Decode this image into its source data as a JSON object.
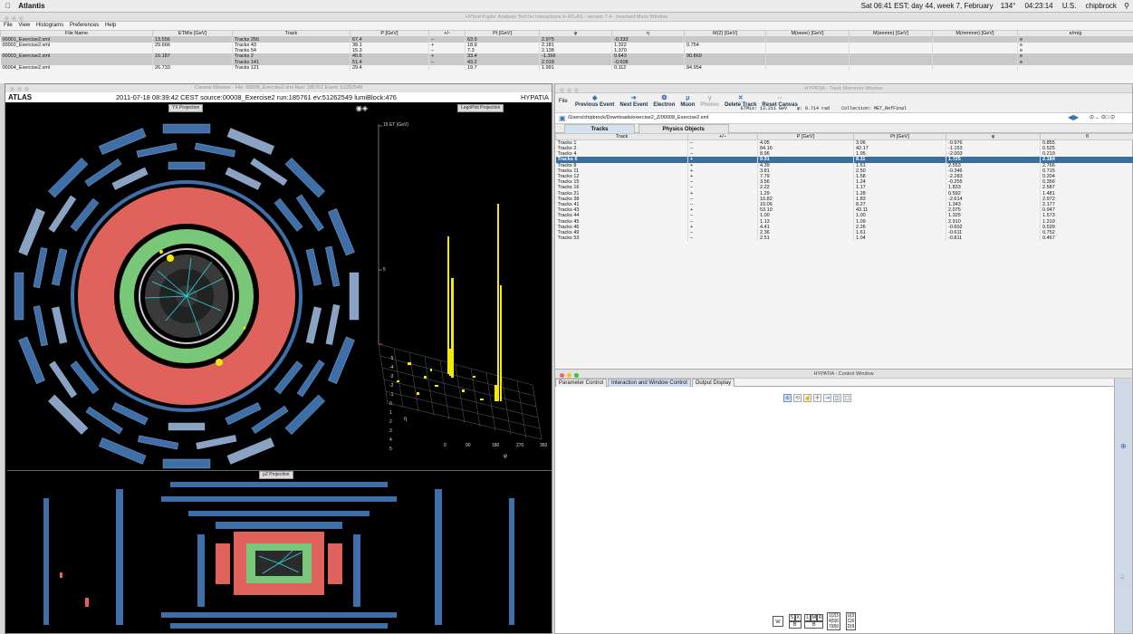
{
  "menubar": {
    "app": "Atlantis",
    "status": "Sat 06:41 EST; day 44, week 7, February",
    "battery": "134°",
    "clock": "04:23:14",
    "locale": "U.S.",
    "user": "chipbrock"
  },
  "main_window": {
    "title": "HYbrid Pupils' Analysis Tool for Interactions in ATLAS - version 7.4 - Invariant Mass Window",
    "menu": [
      "File",
      "View",
      "Histograms",
      "Preferences",
      "Help"
    ],
    "columns": [
      "File Name",
      "ETMis [GeV]",
      "Track",
      "P [GeV]",
      "+/-",
      "Pt [GeV]",
      "φ",
      "η",
      "M(2) [GeV]",
      "M(eeee) [GeV]",
      "M(eemm) [GeV]",
      "M(mmmm) [GeV]",
      "e/m/g"
    ],
    "rows": [
      {
        "file": "00001_Exercise2.xml",
        "etmis": "13.556",
        "track": "Tracks 256",
        "p": "67.4",
        "sign": "–",
        "pt": "63.9",
        "phi": "2.975",
        "eta": "-0.333",
        "m2": "",
        "emg": "e",
        "alt": true
      },
      {
        "file": "00002_Exercise2.xml",
        "etmis": "29.666",
        "track": "Tracks 43",
        "p": "38.1",
        "sign": "+",
        "pt": "18.9",
        "phi": "2.181",
        "eta": "1.322",
        "m2": "0.754",
        "emg": "e",
        "alt": false
      },
      {
        "file": "",
        "etmis": "",
        "track": "Tracks 54",
        "p": "15.3",
        "sign": "–",
        "pt": "7.3",
        "phi": "2.138",
        "eta": "1.370",
        "m2": "",
        "emg": "e",
        "alt": false
      },
      {
        "file": "00003_Exercise2.xml",
        "etmis": "16.187",
        "track": "Tracks 2",
        "p": "40.6",
        "sign": "+",
        "pt": "33.4",
        "phi": "-1.366",
        "eta": "0.643",
        "m2": "90.869",
        "emg": "e",
        "alt": true
      },
      {
        "file": "",
        "etmis": "",
        "track": "Tracks 141",
        "p": "51.4",
        "sign": "–",
        "pt": "43.2",
        "phi": "2.018",
        "eta": "-0.608",
        "m2": "",
        "emg": "e",
        "alt": true
      },
      {
        "file": "00004_Exercise2.xml",
        "etmis": "26.733",
        "track": "Tracks 121",
        "p": "29.4",
        "sign": "",
        "pt": "19.7",
        "phi": "1.991",
        "eta": "0.112",
        "m2": "84.954",
        "emg": "",
        "alt": false
      }
    ]
  },
  "canvas": {
    "title": "Canvas Window - File: 00008_Exercise2.xml  Run: 185761  Event: 51262549",
    "brand_left": "ATLAS",
    "event_info": "2011-07-18 08:39:42 CEST source:00008_Exercise2 run:185761 ev:51262549 lumiBlock:476",
    "brand_right": "HYPATIA",
    "yx_label": "YX Projection",
    "lego_label": "LegoPlot Projection",
    "rz_label": "ρZ Projection",
    "lego_et": "15 ET (GeV)",
    "lego_mid": "5",
    "phi_ticks": [
      "0",
      "90",
      "180",
      "270",
      "360"
    ],
    "phi_label": "φ",
    "eta_label": "η",
    "eta_ticks": [
      "-5",
      "-4",
      "-3",
      "-2",
      "-1",
      "0",
      "1",
      "2",
      "3",
      "4",
      "5"
    ]
  },
  "track_window": {
    "title": "HYPATIA - Track Momenta Window",
    "file_menu": "File",
    "buttons": [
      {
        "label": "Previous Event",
        "icon": "arrow-left-icon",
        "glyph": "◆",
        "disabled": false
      },
      {
        "label": "Next Event",
        "icon": "arrow-right-icon",
        "glyph": "➔",
        "disabled": false
      },
      {
        "label": "Electron",
        "icon": "electron-icon",
        "glyph": "❂",
        "disabled": false
      },
      {
        "label": "Muon",
        "icon": "muon-icon",
        "glyph": "μ",
        "disabled": false
      },
      {
        "label": "Photon",
        "icon": "photon-icon",
        "glyph": "γ",
        "disabled": true
      },
      {
        "label": "Delete Track",
        "icon": "delete-icon",
        "glyph": "✕",
        "disabled": false
      },
      {
        "label": "Reset Canvas",
        "icon": "reset-icon",
        "glyph": "⇔",
        "disabled": false
      }
    ],
    "etmis": "ETMis: 13.211 GeV",
    "phi": "φ: 0.714 rad",
    "collection": "Collection: MET_RefFinal",
    "path": "/Users/chipbrock/Downloads/exercise2_Z/00008_Exercise2.xml",
    "tabs": [
      "Tracks",
      "Physics Objects"
    ],
    "columns": [
      "Track",
      "+/–",
      "P [GeV]",
      "Pt [GeV]",
      "φ",
      "θ"
    ],
    "rows": [
      {
        "track": "Tracks 1",
        "sign": "–",
        "p": "4.05",
        "pt": "3.06",
        "phi": "-0.976",
        "theta": "0.855"
      },
      {
        "track": "Tracks 2",
        "sign": "–",
        "p": "84.16",
        "pt": "42.17",
        "phi": "-1.153",
        "theta": "0.525"
      },
      {
        "track": "Tracks 4",
        "sign": "–",
        "p": "8.96",
        "pt": "1.95",
        "phi": "-2.003",
        "theta": "0.219"
      },
      {
        "track": "Tracks 6",
        "sign": "+",
        "p": "9.91",
        "pt": "8.11",
        "phi": "1.725",
        "theta": "2.184",
        "selected": true
      },
      {
        "track": "Tracks 8",
        "sign": "+",
        "p": "4.39",
        "pt": "1.61",
        "phi": "2.553",
        "theta": "2.766"
      },
      {
        "track": "Tracks 11",
        "sign": "+",
        "p": "3.81",
        "pt": "2.50",
        "phi": "-0.346",
        "theta": "0.715"
      },
      {
        "track": "Tracks 12",
        "sign": "+",
        "p": "7.79",
        "pt": "1.58",
        "phi": "-2.283",
        "theta": "0.204"
      },
      {
        "track": "Tracks 15",
        "sign": "–",
        "p": "3.56",
        "pt": "1.24",
        "phi": "-0.255",
        "theta": "0.356"
      },
      {
        "track": "Tracks 16",
        "sign": "–",
        "p": "2.22",
        "pt": "1.17",
        "phi": "1.833",
        "theta": "2.587"
      },
      {
        "track": "Tracks 21",
        "sign": "+",
        "p": "1.29",
        "pt": "1.28",
        "phi": "0.592",
        "theta": "1.481"
      },
      {
        "track": "Tracks 38",
        "sign": "–",
        "p": "10.82",
        "pt": "1.83",
        "phi": "-2.614",
        "theta": "2.972"
      },
      {
        "track": "Tracks 41",
        "sign": "–",
        "p": "10.06",
        "pt": "8.27",
        "phi": "1.343",
        "theta": "2.177"
      },
      {
        "track": "Tracks 43",
        "sign": "+",
        "p": "53.10",
        "pt": "43.11",
        "phi": "2.075",
        "theta": "0.947"
      },
      {
        "track": "Tracks 44",
        "sign": "–",
        "p": "1.00",
        "pt": "1.00",
        "phi": "1.325",
        "theta": "1.573"
      },
      {
        "track": "Tracks 45",
        "sign": "–",
        "p": "1.13",
        "pt": "1.09",
        "phi": "2.910",
        "theta": "1.319"
      },
      {
        "track": "Tracks 46",
        "sign": "+",
        "p": "4.41",
        "pt": "2.26",
        "phi": "-0.602",
        "theta": "0.539"
      },
      {
        "track": "Tracks 49",
        "sign": "–",
        "p": "2.36",
        "pt": "1.61",
        "phi": "-0.611",
        "theta": "0.752"
      },
      {
        "track": "Tracks 53",
        "sign": "–",
        "p": "2.51",
        "pt": "1.04",
        "phi": "-0.811",
        "theta": "0.467"
      }
    ]
  },
  "control_window": {
    "title": "HYPATIA - Control Window",
    "tabs": [
      "Parameter Control",
      "Interaction and Window Control",
      "Output Display"
    ],
    "active_tab": 1,
    "tools": [
      {
        "name": "zoom-icon",
        "glyph": "⊕",
        "active": true
      },
      {
        "name": "rotate-icon",
        "glyph": "⟲",
        "active": false
      },
      {
        "name": "pick-icon",
        "glyph": "☝",
        "active": false
      },
      {
        "name": "crosshair-icon",
        "glyph": "✛",
        "active": false
      },
      {
        "name": "move-icon",
        "glyph": "⇥",
        "active": false
      },
      {
        "name": "clip-icon",
        "glyph": "◫",
        "active": false
      },
      {
        "name": "fisheye-icon",
        "glyph": "▢",
        "active": false
      }
    ],
    "keys": {
      "w": "W",
      "s": "S",
      "x": "X",
      "b1": "B",
      "l": "L",
      "m": "M",
      "r": "R",
      "b2": "B"
    }
  },
  "colors": {
    "lar": "#e0625d",
    "em": "#79c879",
    "hcal": "#3e6fa8",
    "yellow": "#f3ea00",
    "track": "#29d9e0",
    "selection": "#3b6d9d"
  }
}
